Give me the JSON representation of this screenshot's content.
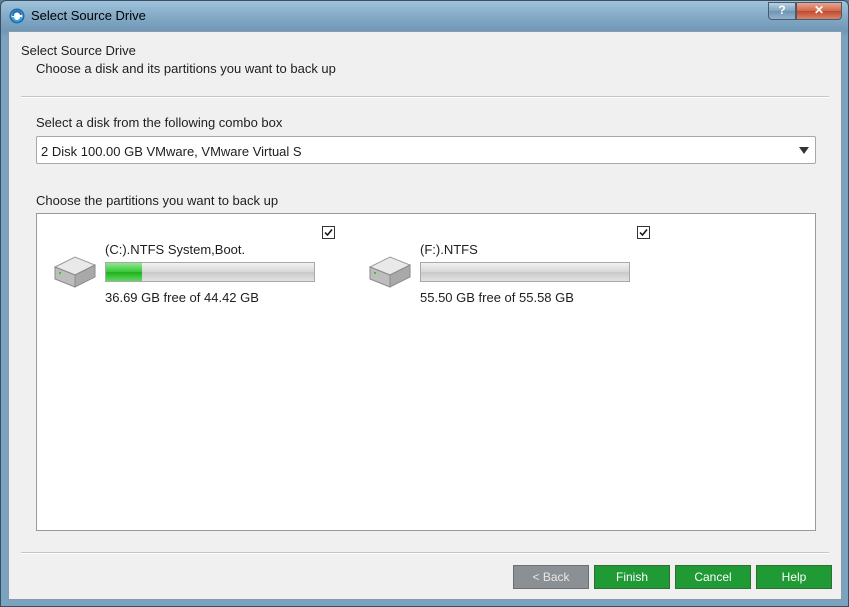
{
  "window": {
    "title": "Select Source Drive",
    "help_glyph": "?",
    "close_glyph": "✕"
  },
  "header": {
    "title": "Select Source Drive",
    "subtitle": "Choose a disk and its partitions you want to back up"
  },
  "disk_select": {
    "label": "Select a disk from the following combo box",
    "value": "2 Disk 100.00 GB VMware,  VMware Virtual S"
  },
  "partitions": {
    "label": "Choose the partitions you want to back up",
    "items": [
      {
        "name": "(C:).NTFS System,Boot.",
        "free_text": "36.69 GB free of 44.42 GB",
        "used_fraction": 0.174,
        "checked": true
      },
      {
        "name": "(F:).NTFS",
        "free_text": "55.50 GB free of 55.58 GB",
        "used_fraction": 0.0015,
        "checked": true
      }
    ]
  },
  "buttons": {
    "back": "< Back",
    "finish": "Finish",
    "cancel": "Cancel",
    "help": "Help"
  },
  "colors": {
    "button_green": "#1f9a34",
    "usage_green": "#2fbf2f",
    "back_gray": "#8a9094"
  }
}
